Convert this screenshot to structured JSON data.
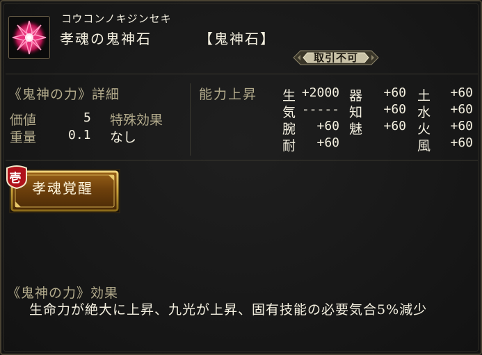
{
  "item": {
    "reading": "コウコンノキジンセキ",
    "name": "孝魂の鬼神石",
    "category": "【鬼神石】",
    "icon": "pink-crystal-gem-icon",
    "badge": "取引不可"
  },
  "details": {
    "title": "《鬼神の力》詳細",
    "value_label": "価値",
    "value": "5",
    "weight_label": "重量",
    "weight": "0.1",
    "special_label": "特殊効果",
    "special_value": "なし"
  },
  "stats": {
    "title": "能力上昇",
    "items": [
      {
        "label": "生",
        "value": "+2000"
      },
      {
        "label": "気",
        "value": "-----"
      },
      {
        "label": "腕",
        "value": "+60"
      },
      {
        "label": "耐",
        "value": "+60"
      },
      {
        "label": "器",
        "value": "+60"
      },
      {
        "label": "知",
        "value": "+60"
      },
      {
        "label": "魅",
        "value": "+60"
      },
      {
        "label": "土",
        "value": "+60"
      },
      {
        "label": "水",
        "value": "+60"
      },
      {
        "label": "火",
        "value": "+60"
      },
      {
        "label": "風",
        "value": "+60"
      }
    ]
  },
  "action": {
    "mark": "壱",
    "label": "孝魂覚醒"
  },
  "effect": {
    "title": "《鬼神の力》効果",
    "text": "生命力が絶大に上昇、九光が上昇、固有技能の必要気合5%減少"
  },
  "colors": {
    "background": "#181818",
    "text": "#f4f0e0",
    "muted_text": "#b3ab8c",
    "gold_border": "#c9a23a",
    "badge": "#c8c1a6",
    "button_fill": "#7a4a10",
    "mark_red": "#b0121a"
  }
}
